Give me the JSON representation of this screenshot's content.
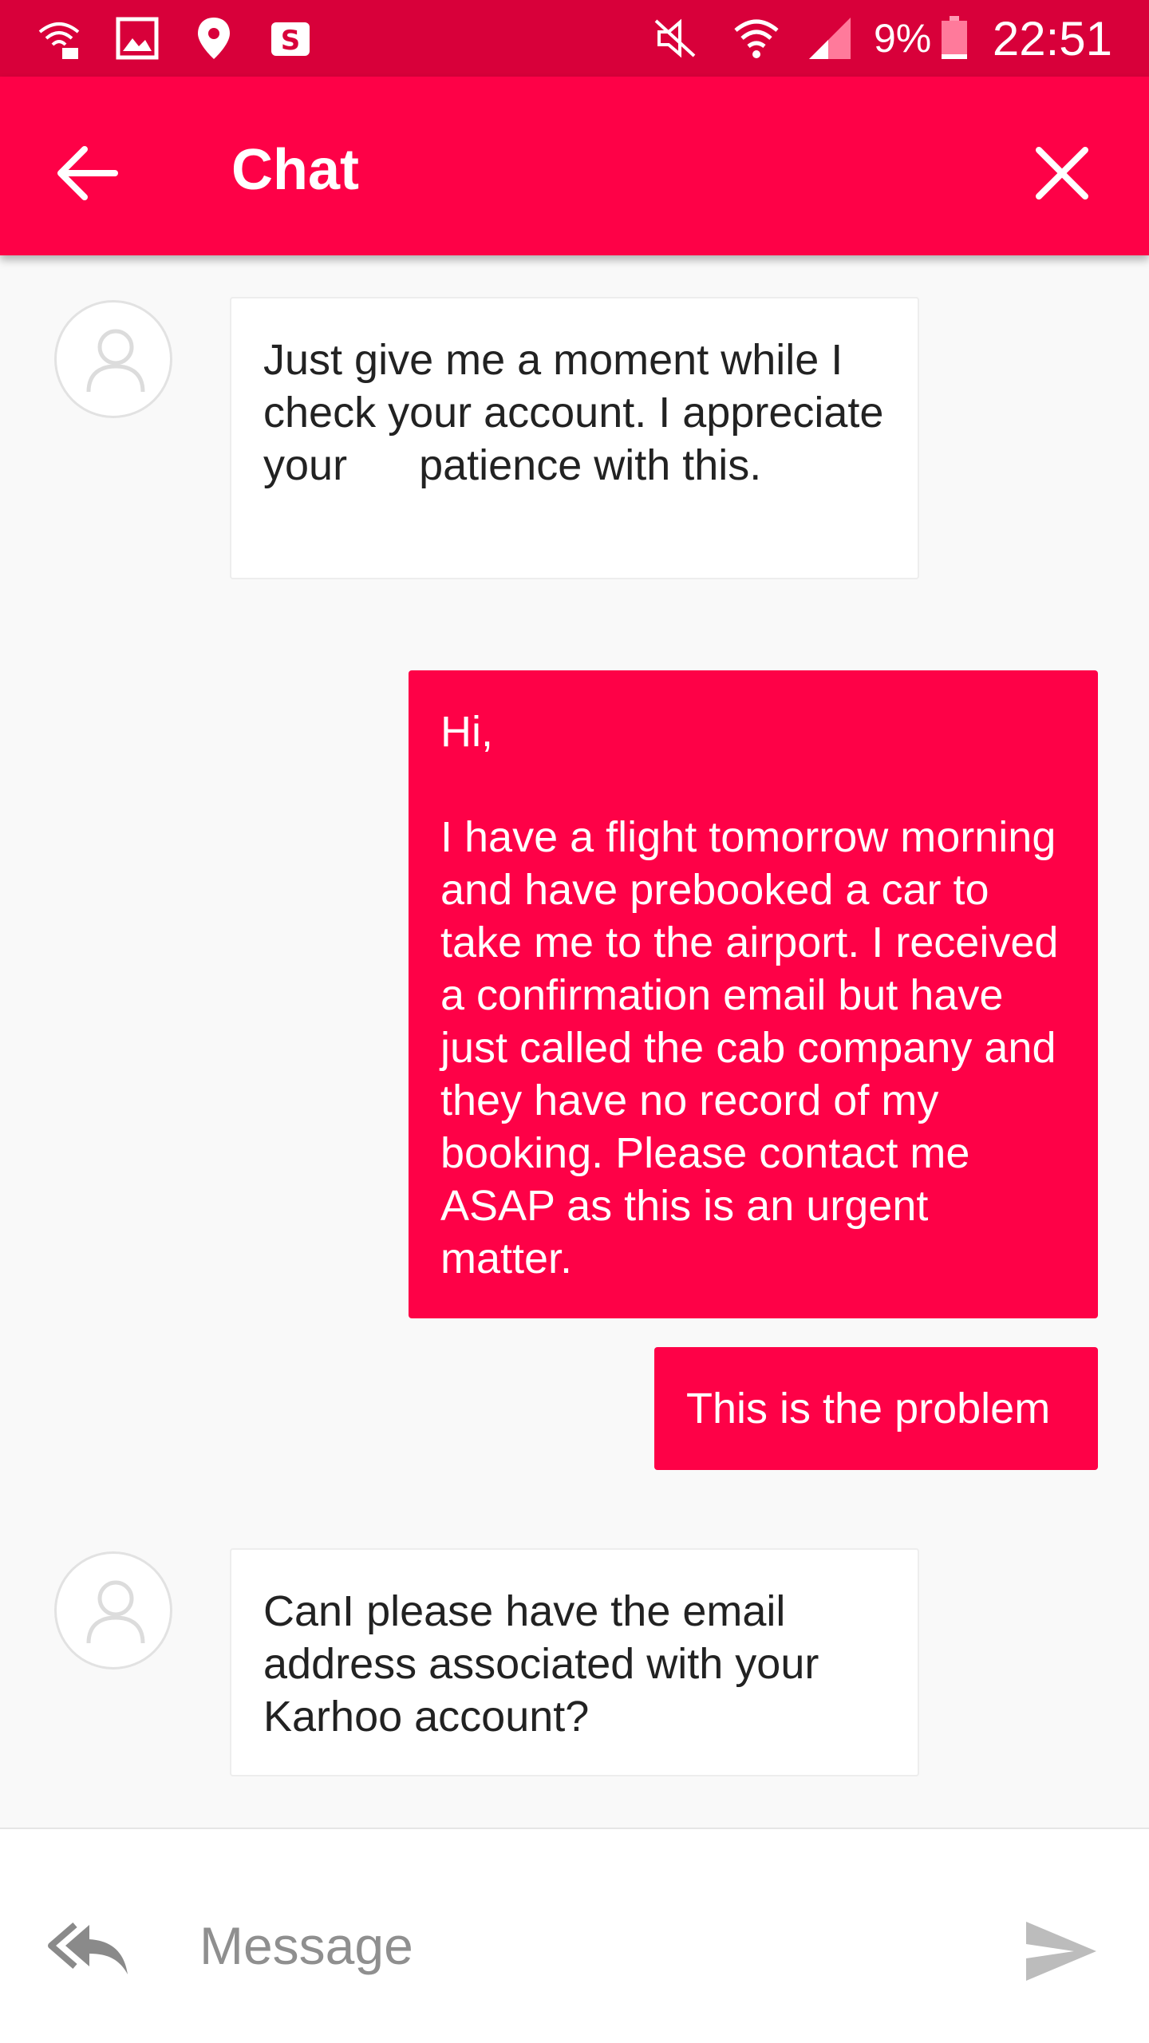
{
  "status_bar": {
    "battery_percent": "9%",
    "time": "22:51",
    "icons": [
      "wifi-calling-icon",
      "gallery-icon",
      "location-icon",
      "shopping-icon",
      "mute-icon",
      "wifi-icon",
      "signal-icon",
      "battery-icon"
    ]
  },
  "app_bar": {
    "title": "Chat",
    "back_icon": "arrow-back-icon",
    "close_icon": "close-icon",
    "background": "#fe0147"
  },
  "messages": [
    {
      "direction": "incoming",
      "text": "Just give me a moment while I check your account. I appreciate your      patience with this."
    },
    {
      "direction": "outgoing",
      "text": "Hi,\n\nI have a flight tomorrow morning and have prebooked a car to take me to the airport. I received a confirmation email but have just called the cab company and they have no record of my booking. Please contact me ASAP as this is an urgent matter."
    },
    {
      "direction": "outgoing",
      "text": "This is the problem"
    },
    {
      "direction": "incoming",
      "text": "CanI please have the email address associated with your Karhoo account?"
    }
  ],
  "composer": {
    "placeholder": "Message",
    "value": "",
    "reply_icon": "reply-all-icon",
    "send_icon": "send-icon"
  },
  "colors": {
    "accent": "#fe0147",
    "status_bar": "#d8003a",
    "incoming_bubble": "#ffffff"
  }
}
